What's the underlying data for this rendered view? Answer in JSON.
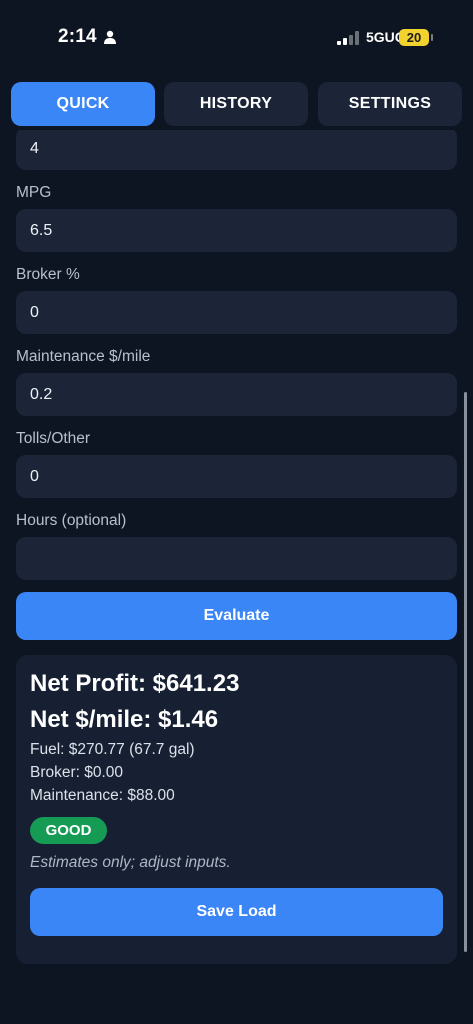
{
  "status_bar": {
    "time": "2:14",
    "network": "5GUC",
    "battery": "20",
    "icons": [
      "person-icon",
      "signal-icon"
    ]
  },
  "tabs": [
    {
      "label": "QUICK",
      "active": true
    },
    {
      "label": "HISTORY",
      "active": false
    },
    {
      "label": "SETTINGS",
      "active": false
    }
  ],
  "form": {
    "top_field_value": "4",
    "fields": [
      {
        "label": "MPG",
        "value": "6.5"
      },
      {
        "label": "Broker %",
        "value": "0"
      },
      {
        "label": "Maintenance $/mile",
        "value": "0.2"
      },
      {
        "label": "Tolls/Other",
        "value": "0"
      },
      {
        "label": "Hours (optional)",
        "value": ""
      }
    ],
    "evaluate_label": "Evaluate"
  },
  "result": {
    "net_profit": "Net Profit: $641.23",
    "net_per_mile": "Net $/mile: $1.46",
    "fuel": "Fuel: $270.77 (67.7 gal)",
    "broker": "Broker: $0.00",
    "maintenance": "Maintenance: $88.00",
    "rating": "GOOD",
    "note": "Estimates only; adjust inputs.",
    "save_label": "Save Load"
  },
  "colors": {
    "background": "#0d1422",
    "accent": "#3b86f7",
    "field": "#1c2538",
    "card": "#172032",
    "good": "#169b55",
    "battery": "#f2d22e"
  }
}
